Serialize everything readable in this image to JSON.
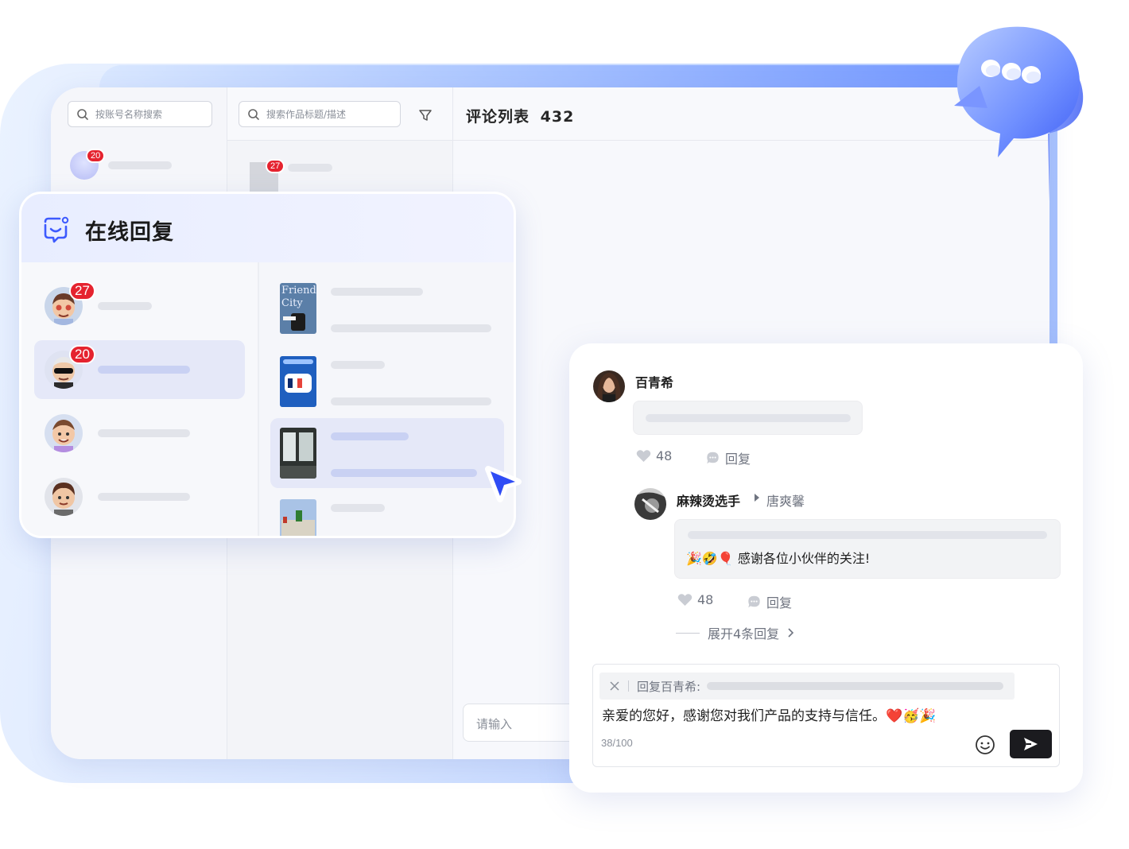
{
  "window": {
    "account_search_placeholder": "按账号名称搜索",
    "works_search_placeholder": "搜索作品标题/描述",
    "comment_list_title": "评论列表",
    "comment_count": "432",
    "input_placeholder": "请输入",
    "account_badge": "20",
    "works_badge": "27"
  },
  "card": {
    "title": "在线回复",
    "accounts": [
      {
        "badge": "27"
      },
      {
        "badge": "20",
        "selected": true
      },
      {
        "badge": ""
      },
      {
        "badge": ""
      }
    ],
    "works": [
      {
        "thumb_text": "Friend City"
      },
      {
        "thumb_text": ""
      },
      {
        "thumb_text": "",
        "selected": true
      },
      {
        "thumb_text": ""
      }
    ]
  },
  "comments": {
    "top": {
      "author": "百青希",
      "likes": "48",
      "reply_label": "回复"
    },
    "reply": {
      "author": "麻辣烫选手",
      "reply_to": "唐爽馨",
      "text": "感谢各位小伙伴的关注!",
      "emojis": "🎉🤣🎈",
      "likes": "48",
      "reply_label": "回复"
    },
    "expand_label": "展开4条回复"
  },
  "editor": {
    "quote_label": "回复百青希:",
    "text": "亲爱的您好，感谢您对我们产品的支持与信任。",
    "emojis": "❤️🥳🎉",
    "counter": "38/100"
  },
  "colors": {
    "badge": "#e5232f",
    "accent_blue": "#3d5afe",
    "selection": "#e5e8f8",
    "send_button": "#1b1b1f"
  }
}
